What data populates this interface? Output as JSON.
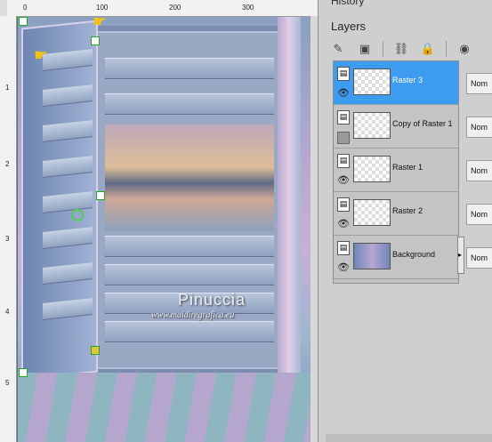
{
  "canvas": {
    "ruler_top_labels": [
      "0",
      "100",
      "200",
      "300"
    ],
    "ruler_left_labels": [
      "1",
      "2",
      "3",
      "4",
      "5"
    ],
    "watermark_name": "Pinuccia",
    "watermark_url": "www.maidiregrafica.eu"
  },
  "panel": {
    "history_tab": "History",
    "layers_title": "Layers",
    "toolbar_icons": [
      "brush-icon",
      "mask-icon",
      "link-icon",
      "lock-icon",
      "globe-icon"
    ]
  },
  "layers": [
    {
      "name": "Raster 3",
      "selected": true,
      "visible": true,
      "blend": "Nom"
    },
    {
      "name": "Copy of Raster 1",
      "selected": false,
      "visible": false,
      "blend": "Nom"
    },
    {
      "name": "Raster 1",
      "selected": false,
      "visible": true,
      "blend": "Nom"
    },
    {
      "name": "Raster 2",
      "selected": false,
      "visible": true,
      "blend": "Nom"
    },
    {
      "name": "Background",
      "selected": false,
      "visible": true,
      "blend": "Nom"
    }
  ],
  "colors": {
    "selection": "#3d9bf0",
    "panel_bg": "#cfcfcf",
    "handle": "#22aa22",
    "pointer": "#f3c21a"
  }
}
